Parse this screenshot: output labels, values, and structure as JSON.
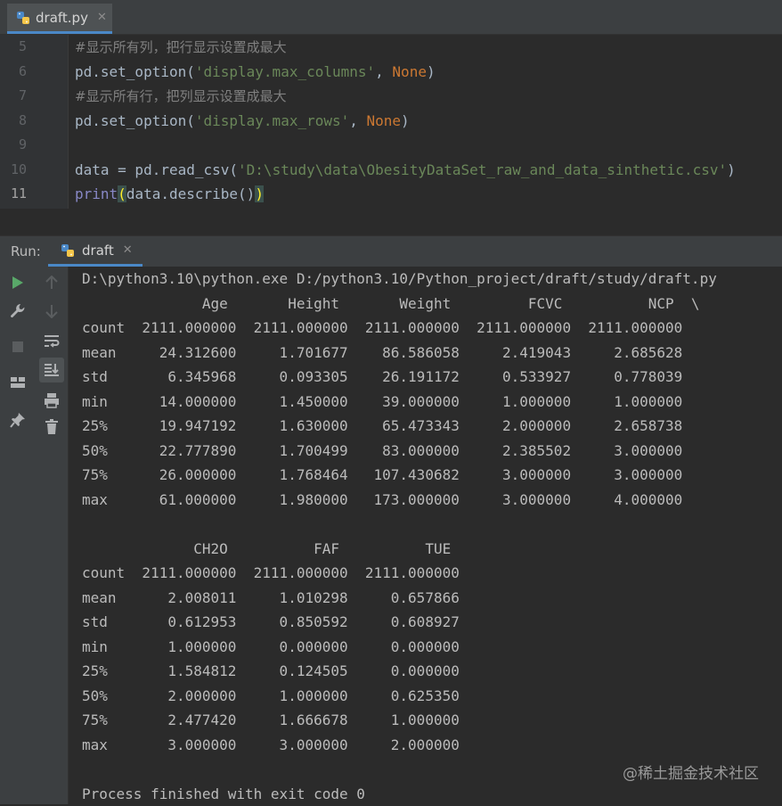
{
  "editor": {
    "tab": {
      "label": "draft.py"
    },
    "lines": [
      {
        "num": "5",
        "parts": [
          {
            "t": "#显示所有列，把行显示设置成最大",
            "c": "c-comment"
          }
        ]
      },
      {
        "num": "6",
        "parts": [
          {
            "t": "pd.set_option(",
            "c": "c-plain"
          },
          {
            "t": "'display.max_columns'",
            "c": "c-str"
          },
          {
            "t": ", ",
            "c": "c-plain"
          },
          {
            "t": "None",
            "c": "c-kw"
          },
          {
            "t": ")",
            "c": "c-plain"
          }
        ]
      },
      {
        "num": "7",
        "parts": [
          {
            "t": "#显示所有行，把列显示设置成最大",
            "c": "c-comment"
          }
        ]
      },
      {
        "num": "8",
        "parts": [
          {
            "t": "pd.set_option(",
            "c": "c-plain"
          },
          {
            "t": "'display.max_rows'",
            "c": "c-str"
          },
          {
            "t": ", ",
            "c": "c-plain"
          },
          {
            "t": "None",
            "c": "c-kw"
          },
          {
            "t": ")",
            "c": "c-plain"
          }
        ]
      },
      {
        "num": "9",
        "parts": []
      },
      {
        "num": "10",
        "parts": [
          {
            "t": "data = pd.read_csv(",
            "c": "c-plain"
          },
          {
            "t": "'D:\\study\\data\\ObesityDataSet_raw_and_data_sinthetic.csv'",
            "c": "c-str"
          },
          {
            "t": ")",
            "c": "c-plain"
          }
        ]
      },
      {
        "num": "11",
        "current": true,
        "parts": [
          {
            "t": "print",
            "c": "c-builtin"
          },
          {
            "t": "(",
            "c": "c-paren-hl"
          },
          {
            "t": "data.describe()",
            "c": "c-plain"
          },
          {
            "t": ")",
            "c": "c-paren-hl"
          }
        ]
      }
    ]
  },
  "run": {
    "label": "Run:",
    "tab": {
      "label": "draft"
    },
    "output": [
      "D:\\python3.10\\python.exe D:/python3.10/Python_project/draft/study/draft.py",
      "              Age       Height       Weight         FCVC          NCP  \\",
      "count  2111.000000  2111.000000  2111.000000  2111.000000  2111.000000",
      "mean     24.312600     1.701677    86.586058     2.419043     2.685628",
      "std       6.345968     0.093305    26.191172     0.533927     0.778039",
      "min      14.000000     1.450000    39.000000     1.000000     1.000000",
      "25%      19.947192     1.630000    65.473343     2.000000     2.658738",
      "50%      22.777890     1.700499    83.000000     2.385502     3.000000",
      "75%      26.000000     1.768464   107.430682     3.000000     3.000000",
      "max      61.000000     1.980000   173.000000     3.000000     4.000000",
      "",
      "             CH2O          FAF          TUE",
      "count  2111.000000  2111.000000  2111.000000",
      "mean      2.008011     1.010298     0.657866",
      "std       0.612953     0.850592     0.608927",
      "min       1.000000     0.000000     0.000000",
      "25%       1.584812     0.124505     0.000000",
      "50%       2.000000     1.000000     0.625350",
      "75%       2.477420     1.666678     1.000000",
      "max       3.000000     3.000000     2.000000",
      "",
      "Process finished with exit code 0"
    ]
  },
  "watermark": "@稀土掘金技术社区"
}
